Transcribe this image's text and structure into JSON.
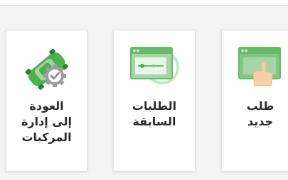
{
  "colors": {
    "accent": "#4caf50",
    "accent_light": "#a5d6a7",
    "icon_gray": "#9e9e9e"
  },
  "cards": [
    {
      "id": "return-to-vehicle-management",
      "icon": "car-gear-icon",
      "label_lines": [
        "العودة",
        "إلى إدارة",
        "المركبات"
      ]
    },
    {
      "id": "previous-requests",
      "icon": "window-clock-icon",
      "label_lines": [
        "الطلبات",
        "السابقة"
      ]
    },
    {
      "id": "new-request",
      "icon": "window-hand-icon",
      "label_lines": [
        "طلب",
        "جديد"
      ]
    }
  ]
}
